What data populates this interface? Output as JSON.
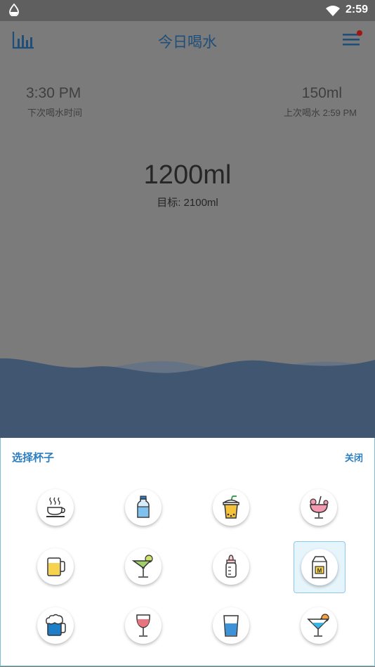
{
  "status_bar": {
    "time": "2:59"
  },
  "app_bar": {
    "title": "今日喝水"
  },
  "next_drink": {
    "time": "3:30 PM",
    "label": "下次喝水时间"
  },
  "last_drink": {
    "amount": "150ml",
    "label": "上次喝水 2:59 PM"
  },
  "today": {
    "intake": "1200ml",
    "goal": "目标: 2100ml"
  },
  "cup_picker": {
    "title": "选择杯子",
    "close_label": "关闭",
    "selected": "milk-carton",
    "cups": [
      "coffee-cup",
      "water-bottle",
      "bubble-tea",
      "tropical-drink",
      "beer-mug",
      "margarita-glass",
      "baby-bottle",
      "milk-carton",
      "beer-foam-mug",
      "wine-glass",
      "water-glass",
      "cocktail-glass"
    ],
    "milk_carton_letter": "M"
  },
  "colors": {
    "accent": "#2b7ec1",
    "title": "#1f4e79",
    "wave": "#415671",
    "overlay": "#7b7b7b"
  }
}
